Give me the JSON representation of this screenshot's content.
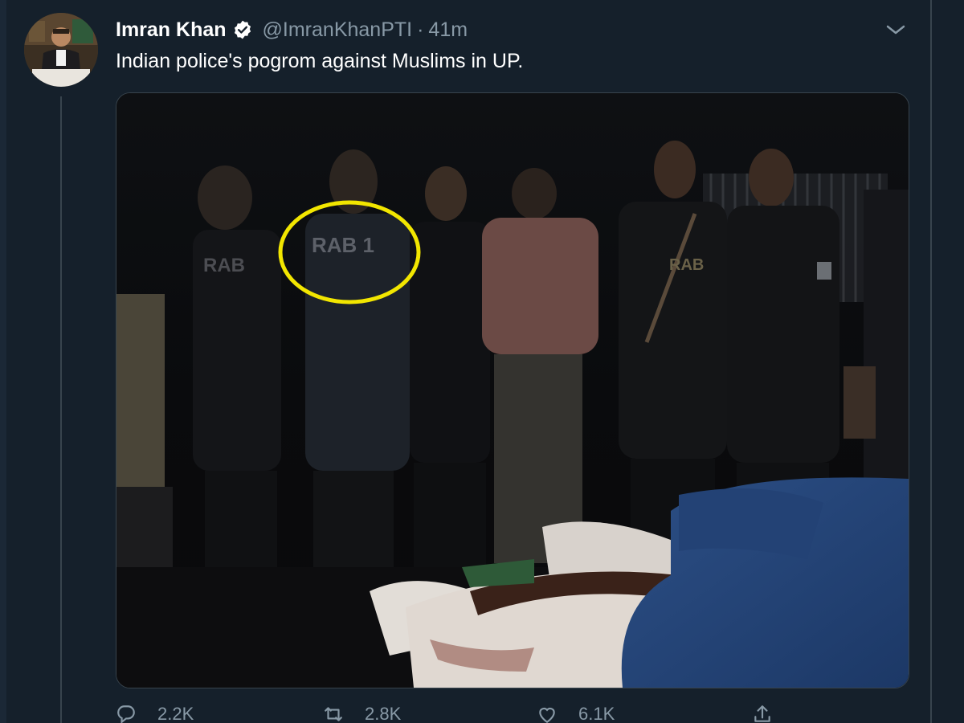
{
  "tweet": {
    "display_name": "Imran Khan",
    "handle": "@ImranKhanPTI",
    "separator": "·",
    "time": "41m",
    "text": "Indian police's pogrom against Muslims in UP."
  },
  "media": {
    "overlay_text_1": "RAB 1",
    "overlay_text_2": "RAB",
    "overlay_text_3": "RAB",
    "annotation_color": "#f2e600"
  },
  "actions": {
    "reply_count": "2.2K",
    "retweet_count": "2.8K",
    "like_count": "6.1K"
  },
  "colors": {
    "background": "#15202b",
    "text_primary": "#ffffff",
    "text_secondary": "#8899a6",
    "border": "#38444d",
    "verified": "#ffffff"
  },
  "icons": {
    "verified": "verified-badge-icon",
    "caret": "chevron-down-icon",
    "reply": "reply-icon",
    "retweet": "retweet-icon",
    "like": "heart-icon",
    "share": "share-icon"
  }
}
